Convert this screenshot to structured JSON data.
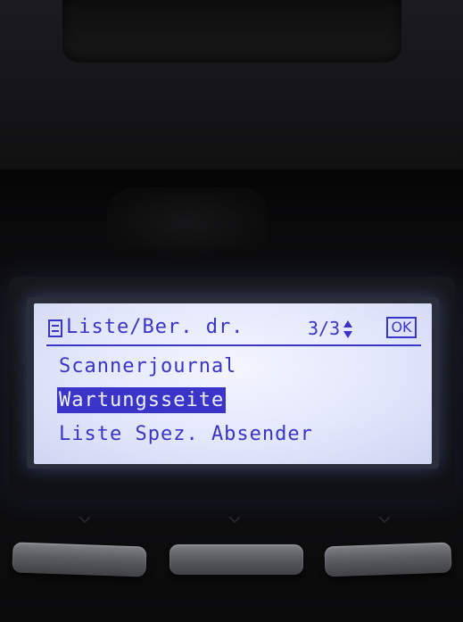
{
  "lcd": {
    "header": {
      "title": "Liste/Ber. dr.",
      "page_indicator": "3/3",
      "ok_label": "OK"
    },
    "items": [
      {
        "label": "Scannerjournal",
        "selected": false
      },
      {
        "label": "Wartungsseite",
        "selected": true
      },
      {
        "label": "Liste Spez. Absender",
        "selected": false
      }
    ]
  },
  "colors": {
    "lcd_text": "#3a34c8",
    "lcd_background": "#e6e9fb",
    "housing": "#0b0b0c",
    "soft_key": "#5b5d61"
  },
  "icons": {
    "menu": "list-menu-icon",
    "scroll": "up-down-arrow-icon",
    "soft_key_chevron": "chevron-down-icon"
  }
}
